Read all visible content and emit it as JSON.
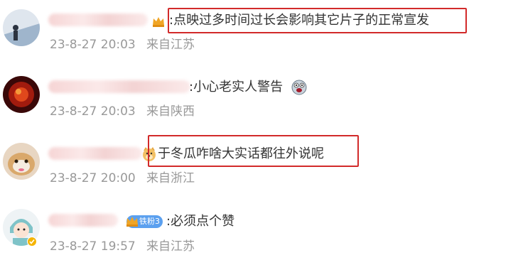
{
  "comments": [
    {
      "text": ":点映过多时间过长会影响其它片子的正常宣发",
      "time": "23-8-27 20:03",
      "location": "来自江苏"
    },
    {
      "text": ":小心老实人警告",
      "time": "23-8-27 20:03",
      "location": "来自陕西"
    },
    {
      "text": "于冬瓜咋啥大实话都往外说呢",
      "time": "23-8-27 20:00",
      "location": "来自浙江"
    },
    {
      "text": ":必须点个赞",
      "time": "23-8-27 19:57",
      "location": "来自江苏",
      "fan_badge": "铁粉3"
    }
  ],
  "colors": {
    "highlight": "#d22a2a",
    "meta_text": "#999999",
    "fan_badge": "#5ba0ef"
  },
  "icons": [
    "crown-badge-icon",
    "grimace-emoji-icon",
    "doge-emoji-icon",
    "fan-crown-icon",
    "verified-icon"
  ]
}
